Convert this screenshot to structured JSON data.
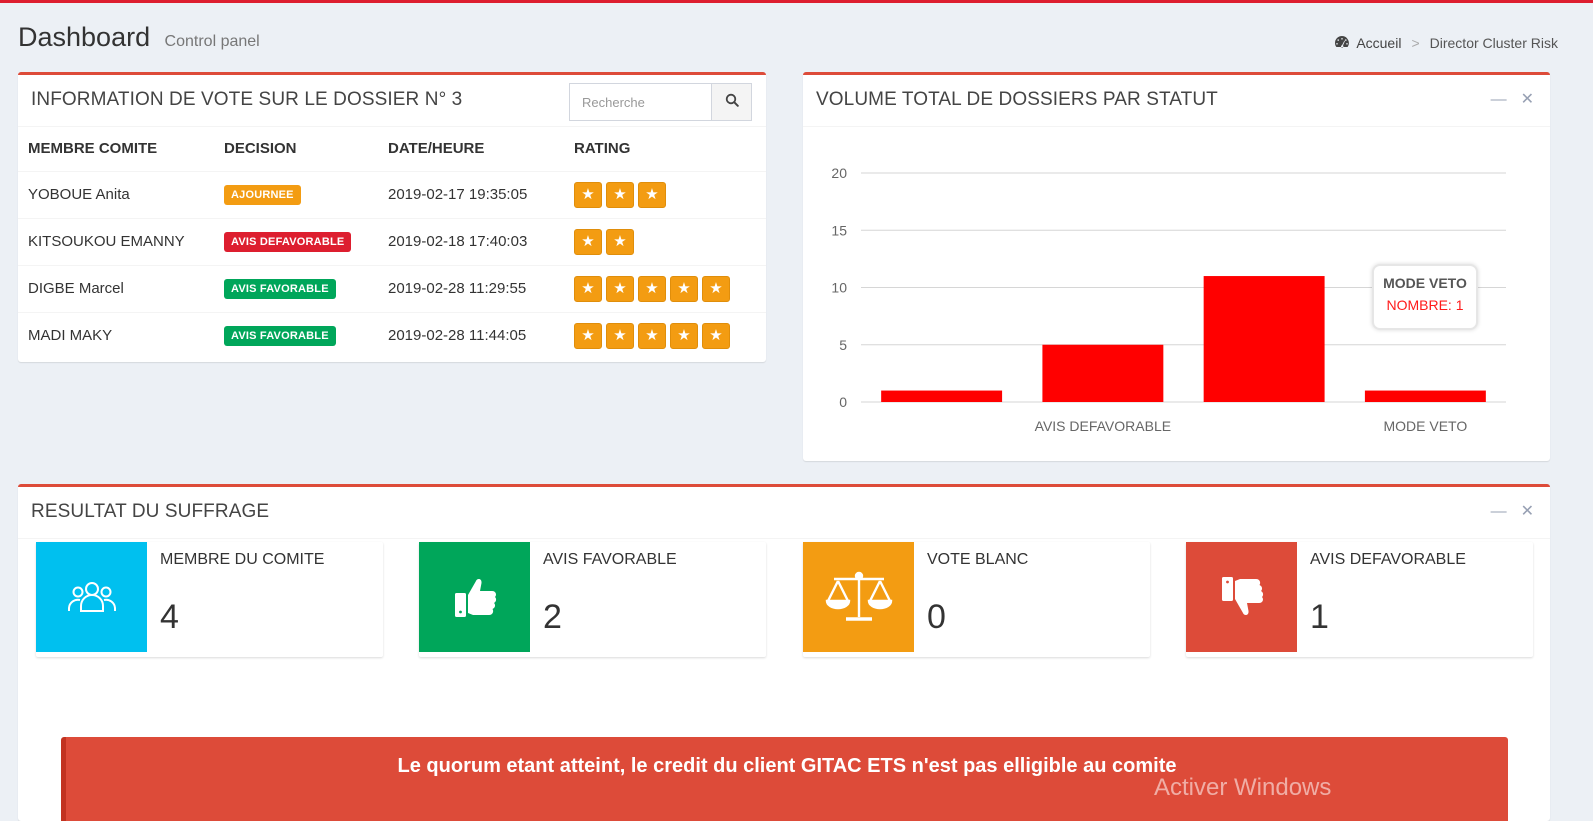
{
  "header": {
    "title": "Dashboard",
    "subtitle": "Control panel",
    "breadcrumb": {
      "home": "Accueil",
      "separator": ">",
      "current": "Director Cluster Risk"
    }
  },
  "vote_panel": {
    "title": "INFORMATION DE VOTE SUR LE DOSSIER N° 3",
    "search_placeholder": "Recherche",
    "columns": [
      "MEMBRE COMITE",
      "DECISION",
      "DATE/HEURE",
      "RATING"
    ],
    "rows": [
      {
        "member": "YOBOUE Anita",
        "decision": "AJOURNEE",
        "decision_color": "#f39c12",
        "datetime": "2019-02-17 19:35:05",
        "rating": 3
      },
      {
        "member": "KITSOUKOU EMANNY",
        "decision": "AVIS DEFAVORABLE",
        "decision_color": "#dd1e2f",
        "datetime": "2019-02-18 17:40:03",
        "rating": 2
      },
      {
        "member": "DIGBE Marcel",
        "decision": "AVIS FAVORABLE",
        "decision_color": "#00a65a",
        "datetime": "2019-02-28 11:29:55",
        "rating": 5
      },
      {
        "member": "MADI MAKY",
        "decision": "AVIS FAVORABLE",
        "decision_color": "#00a65a",
        "datetime": "2019-02-28 11:44:05",
        "rating": 5
      }
    ]
  },
  "chart_panel": {
    "title": "VOLUME TOTAL DE DOSSIERS PAR STATUT",
    "minimize_icon": "minus-icon",
    "close_icon": "times-icon",
    "tooltip": {
      "title": "MODE VETO",
      "value_text": "NOMBRE: 1"
    }
  },
  "chart_data": {
    "type": "bar",
    "categories": [
      "",
      "AVIS DEFAVORABLE",
      "",
      "MODE VETO"
    ],
    "values": [
      1,
      5,
      11,
      1
    ],
    "color": "#ff0000",
    "yticks": [
      0,
      5,
      10,
      15,
      20
    ],
    "ylim": [
      0,
      20
    ],
    "grid": true
  },
  "result_panel": {
    "title": "RESULTAT DU SUFFRAGE",
    "cards": [
      {
        "label": "MEMBRE DU COMITE",
        "value": "4",
        "color": "#00c0ef",
        "icon": "users-icon"
      },
      {
        "label": "AVIS FAVORABLE",
        "value": "2",
        "color": "#00a65a",
        "icon": "thumbs-up-icon"
      },
      {
        "label": "VOTE BLANC",
        "value": "0",
        "color": "#f39c12",
        "icon": "balance-scale-icon"
      },
      {
        "label": "AVIS DEFAVORABLE",
        "value": "1",
        "color": "#dd4b39",
        "icon": "thumbs-down-icon"
      }
    ],
    "alert": "Le quorum etant atteint, le credit du client GITAC ETS n'est pas elligible au comite"
  },
  "watermark": "Activer Windows"
}
